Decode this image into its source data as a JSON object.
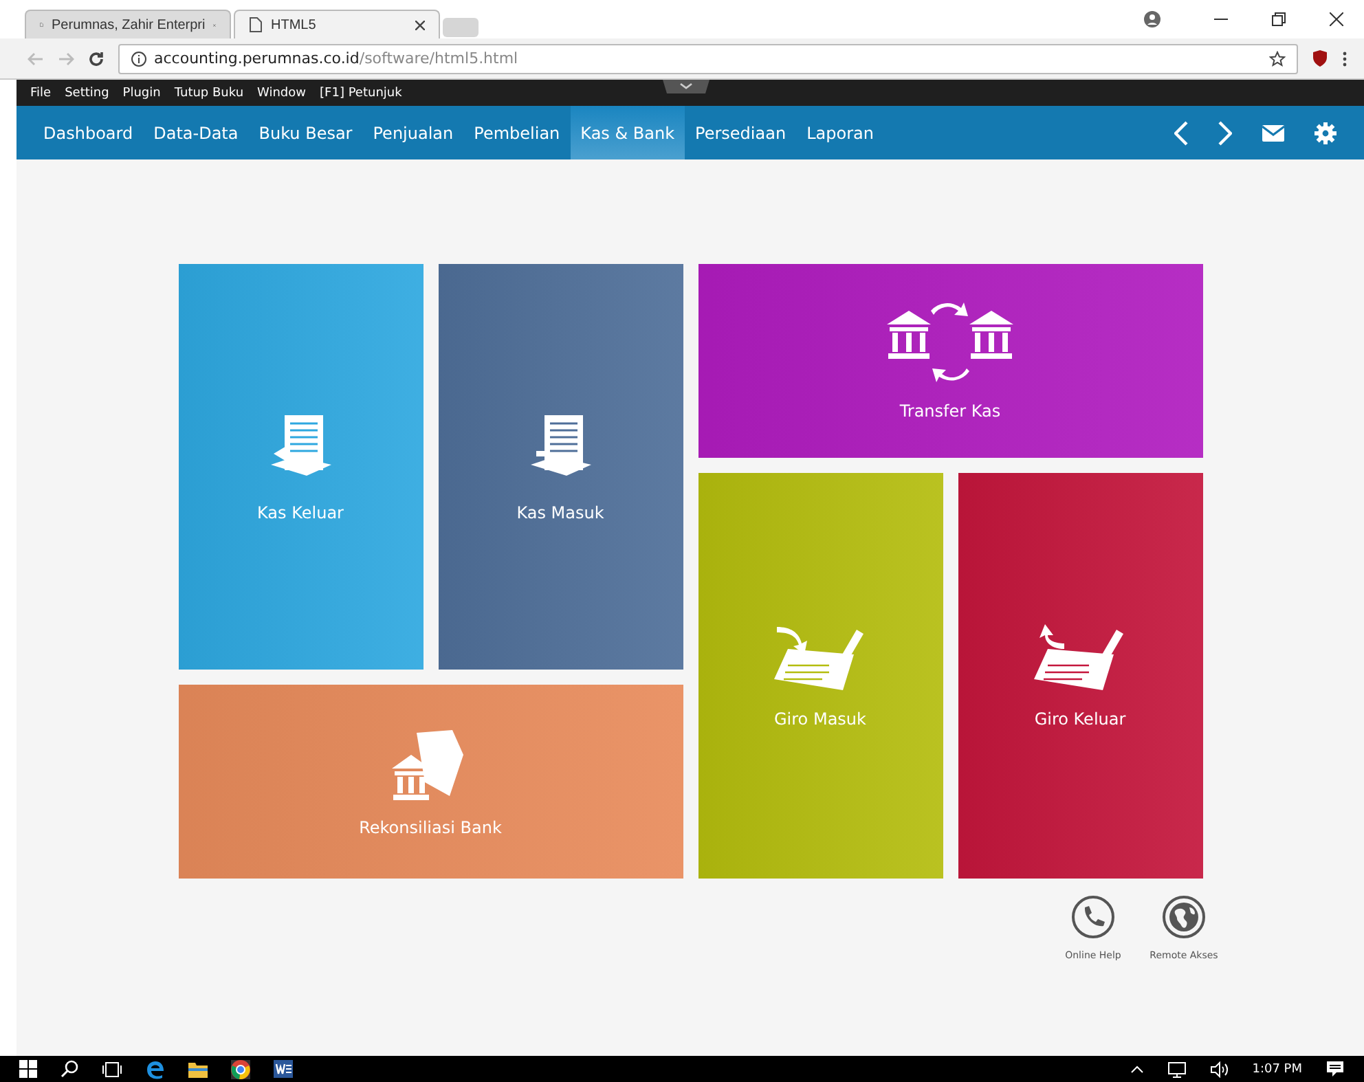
{
  "browser": {
    "tabs": [
      {
        "title": "Perumnas, Zahir Enterpri",
        "selected": false
      },
      {
        "title": "HTML5",
        "selected": true
      }
    ],
    "url_host": "accounting.perumnas.co.id",
    "url_path": "/software/html5.html"
  },
  "menu_bar": [
    "File",
    "Setting",
    "Plugin",
    "Tutup Buku",
    "Window",
    "[F1] Petunjuk"
  ],
  "nav": [
    {
      "label": "Dashboard",
      "selected": false
    },
    {
      "label": "Data-Data",
      "selected": false
    },
    {
      "label": "Buku Besar",
      "selected": false
    },
    {
      "label": "Penjualan",
      "selected": false
    },
    {
      "label": "Pembelian",
      "selected": false
    },
    {
      "label": "Kas & Bank",
      "selected": true
    },
    {
      "label": "Persediaan",
      "selected": false
    },
    {
      "label": "Laporan",
      "selected": false
    }
  ],
  "tiles": [
    {
      "label": "Kas Keluar",
      "kind": "doc-out",
      "color": "#2ea8e0"
    },
    {
      "label": "Kas Masuk",
      "kind": "doc-in",
      "color": "#4f6f99"
    },
    {
      "label": "Transfer Kas",
      "kind": "transfer",
      "color": "#b01cbf"
    },
    {
      "label": "Giro Masuk",
      "kind": "giro-in",
      "color": "#b4bd0e"
    },
    {
      "label": "Giro Keluar",
      "kind": "giro-out",
      "color": "#c4163c"
    },
    {
      "label": "Rekonsiliasi Bank",
      "kind": "bank",
      "color": "#e88b5b"
    }
  ],
  "help_links": [
    {
      "label": "Online Help",
      "kind": "phone"
    },
    {
      "label": "Remote Akses",
      "kind": "globe"
    }
  ],
  "taskbar": {
    "time": "1:07 PM"
  }
}
